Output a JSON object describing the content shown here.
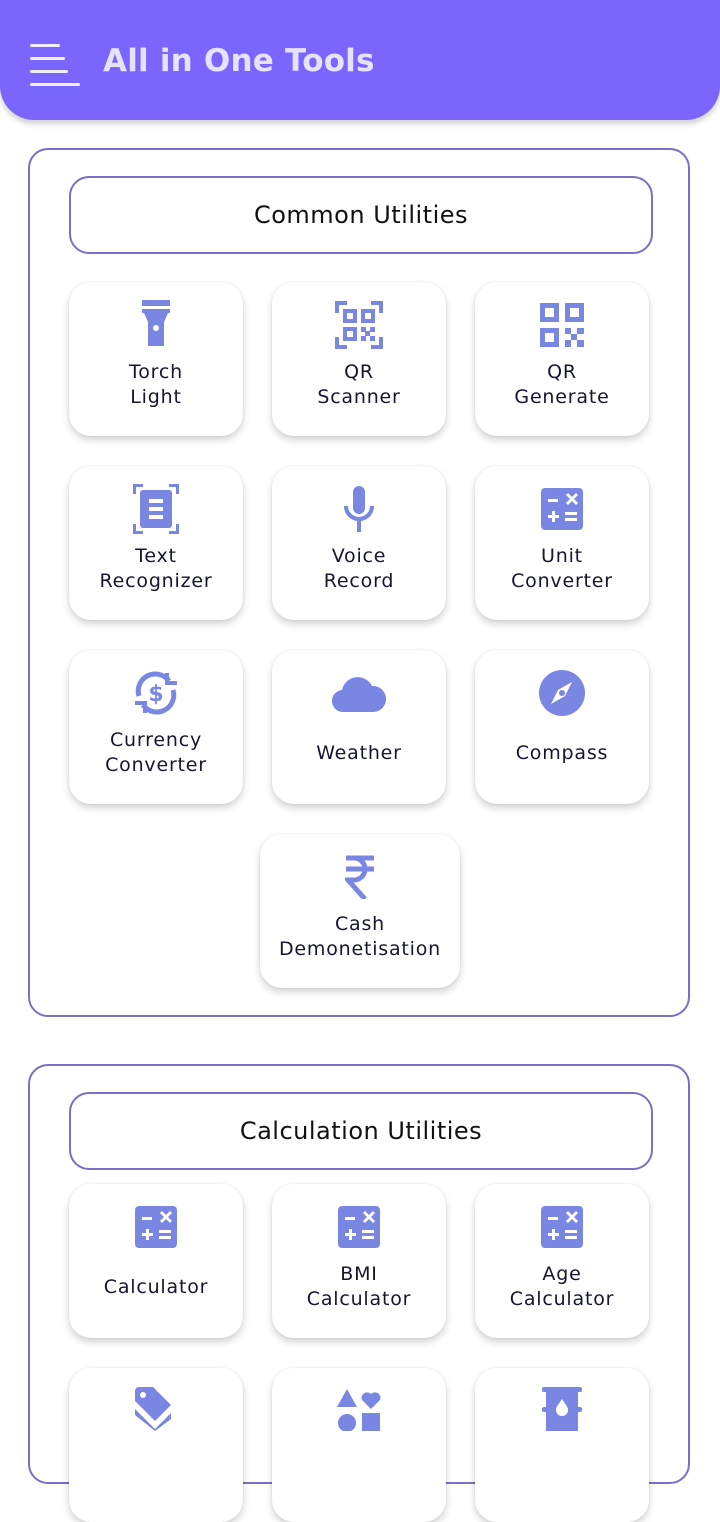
{
  "appbar": {
    "title": "All in One Tools",
    "menu_icon": "hamburger-menu-icon",
    "background": "#7a66fc"
  },
  "colors": {
    "accent": "#7a66fc",
    "icon": "#7987e2",
    "section_border": "#7a6fc4",
    "text": "#151530"
  },
  "sections": [
    {
      "title": "Common Utilities",
      "tiles": [
        {
          "line1": "Torch",
          "line2": "Light",
          "icon": "flashlight-icon"
        },
        {
          "line1": "QR",
          "line2": "Scanner",
          "icon": "qr-scanner-icon"
        },
        {
          "line1": "QR",
          "line2": "Generate",
          "icon": "qr-code-icon"
        },
        {
          "line1": "Text",
          "line2": "Recognizer",
          "icon": "document-scanner-icon"
        },
        {
          "line1": "Voice",
          "line2": "Record",
          "icon": "microphone-icon"
        },
        {
          "line1": "Unit",
          "line2": "Converter",
          "icon": "calculator-icon"
        },
        {
          "line1": "Currency",
          "line2": "Converter",
          "icon": "currency-exchange-icon"
        },
        {
          "line1": "Weather",
          "line2": "",
          "icon": "cloud-icon"
        },
        {
          "line1": "Compass",
          "line2": "",
          "icon": "compass-icon"
        },
        {
          "line1": "Cash",
          "line2": "Demonetisation",
          "icon": "rupee-icon"
        }
      ]
    },
    {
      "title": "Calculation Utilities",
      "tiles": [
        {
          "line1": "Calculator",
          "line2": "",
          "icon": "calculator-icon"
        },
        {
          "line1": "BMI",
          "line2": "Calculator",
          "icon": "calculator-icon"
        },
        {
          "line1": "Age",
          "line2": "Calculator",
          "icon": "calculator-icon"
        },
        {
          "line1": "",
          "line2": "",
          "icon": "discount-tag-icon"
        },
        {
          "line1": "",
          "line2": "",
          "icon": "shapes-icon"
        },
        {
          "line1": "",
          "line2": "",
          "icon": "oil-barrel-icon"
        }
      ]
    }
  ]
}
